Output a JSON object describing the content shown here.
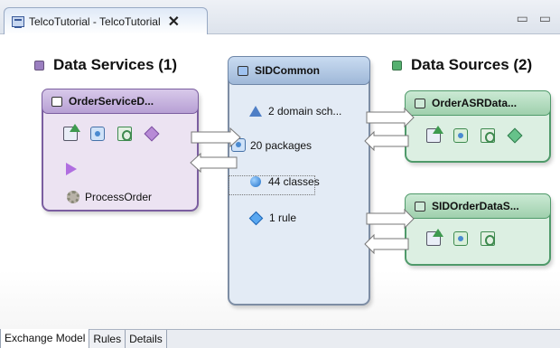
{
  "editor_tab": {
    "title": "TelcoTutorial - TelcoTutorial",
    "close": "✕"
  },
  "window_controls": "▭ ▭",
  "sections": {
    "data_services": {
      "title": "Data Services (1)",
      "color": "#9b7fc0"
    },
    "data_sources": {
      "title": "Data Sources (2)",
      "color": "#55b06f"
    }
  },
  "nodes": {
    "order_service": {
      "title": "OrderServiceD...",
      "operation": "ProcessOrder"
    },
    "sid_common": {
      "title": "SIDCommon",
      "items": [
        "2 domain sch...",
        "20 packages",
        "44 classes",
        "1 rule"
      ]
    },
    "order_asr": {
      "title": "OrderASRData..."
    },
    "sid_order": {
      "title": "SIDOrderDataS..."
    }
  },
  "bottom_tabs": [
    "Exchange Model",
    "Rules",
    "Details"
  ]
}
